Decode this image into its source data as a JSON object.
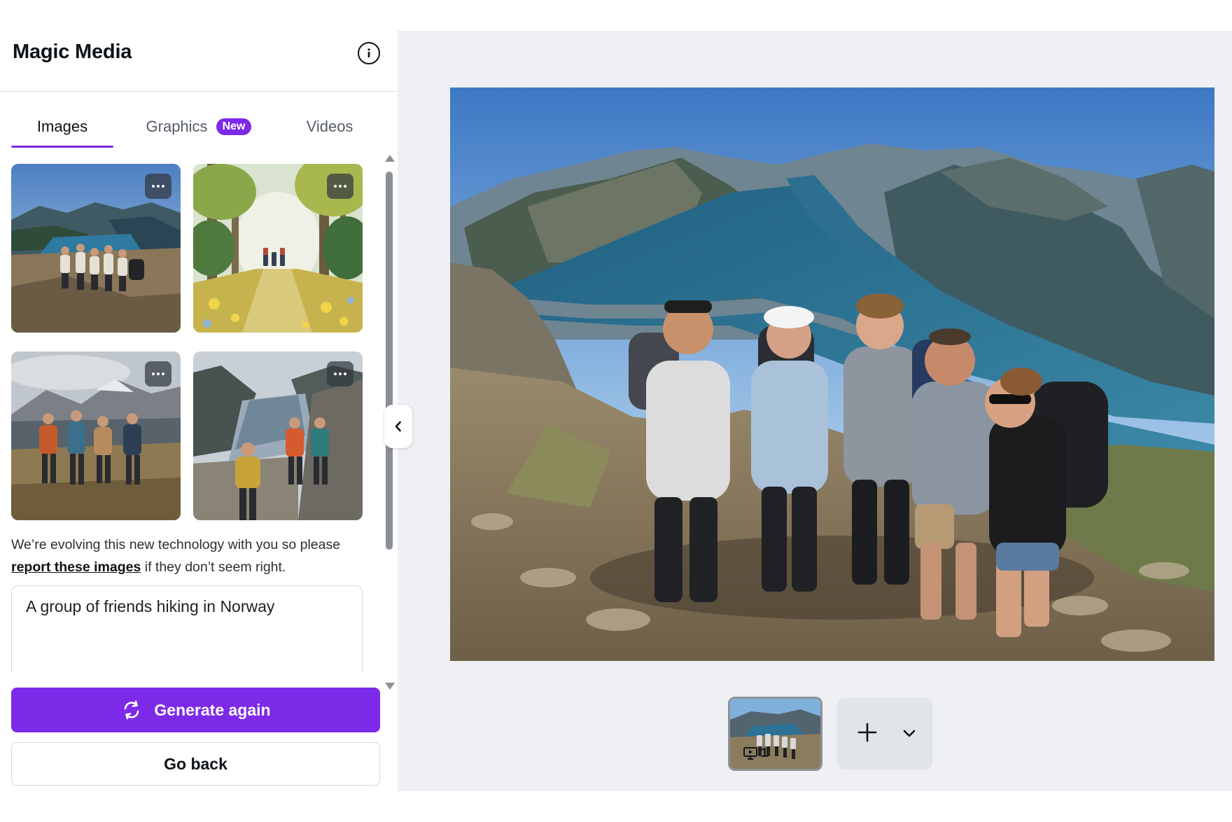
{
  "panel": {
    "title": "Magic Media",
    "info_icon": "info-circle-icon"
  },
  "tabs": [
    {
      "label": "Images",
      "active": true
    },
    {
      "label": "Graphics",
      "badge": "New",
      "active": false
    },
    {
      "label": "Videos",
      "active": false
    }
  ],
  "thumbnails": [
    {
      "subject": "hiking group on fjord overlook",
      "more_icon": "more-horizontal-icon"
    },
    {
      "subject": "watercolor forest path with hikers",
      "more_icon": "more-horizontal-icon"
    },
    {
      "subject": "hikers posing with mountain backdrop",
      "more_icon": "more-horizontal-icon"
    },
    {
      "subject": "hikers beside fjord and cliffs",
      "more_icon": "more-horizontal-icon"
    }
  ],
  "disclaimer": {
    "before": "We’re evolving this new technology with you so please ",
    "link": "report these images",
    "after": " if they don’t seem right."
  },
  "prompt": {
    "value": "A group of friends hiking in Norway"
  },
  "buttons": {
    "generate_label": "Generate again",
    "generate_icon": "refresh-icon",
    "back_label": "Go back"
  },
  "canvas": {
    "collapse_icon": "chevron-left-icon",
    "page_number": "1",
    "page_icon": "presentation-icon",
    "add_icon": "plus-icon",
    "expand_icon": "chevron-down-icon"
  },
  "colors": {
    "accent": "#7d2ae8",
    "canvas_bg": "#eef0f3",
    "text": "#0e1318"
  }
}
